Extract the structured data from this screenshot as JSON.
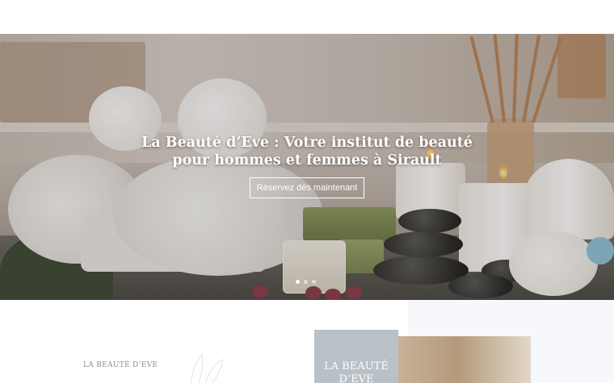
{
  "hero": {
    "title": "La Beauté d’Eve : Votre institut de beauté pour hommes et femmes à Sirault",
    "cta_label": "Réservez dès maintenant",
    "slides_count": 3,
    "active_slide": 1
  },
  "about": {
    "eyebrow": "LA BEAUTÉ D’EVE",
    "badge_line1": "LA BEAUTÉ",
    "badge_line2": "D’EVE"
  },
  "colors": {
    "badge_bg": "#b9c0c6",
    "section_bg": "#f7f8fb",
    "button_border": "#ffffff"
  }
}
